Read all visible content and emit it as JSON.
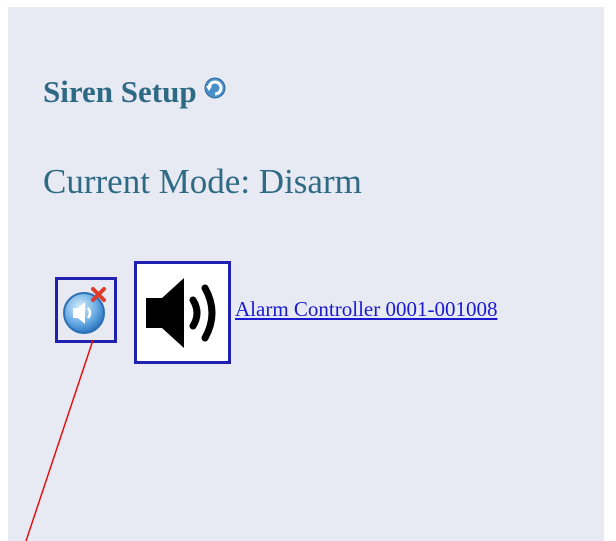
{
  "header": {
    "title": "Siren Setup",
    "refresh_icon": "refresh-icon"
  },
  "status": {
    "mode_text": "Current Mode: Disarm"
  },
  "controls": {
    "mute_icon": "speaker-mute-icon",
    "siren_icon": "speaker-loud-icon"
  },
  "device": {
    "link_text": "Alarm Controller 0001-001008"
  },
  "colors": {
    "heading": "#2f6a85",
    "panel_background": "#e7eaf2",
    "button_border": "#1f1fb0",
    "link": "#1a1ad0",
    "annotation_line": "#e01010"
  }
}
